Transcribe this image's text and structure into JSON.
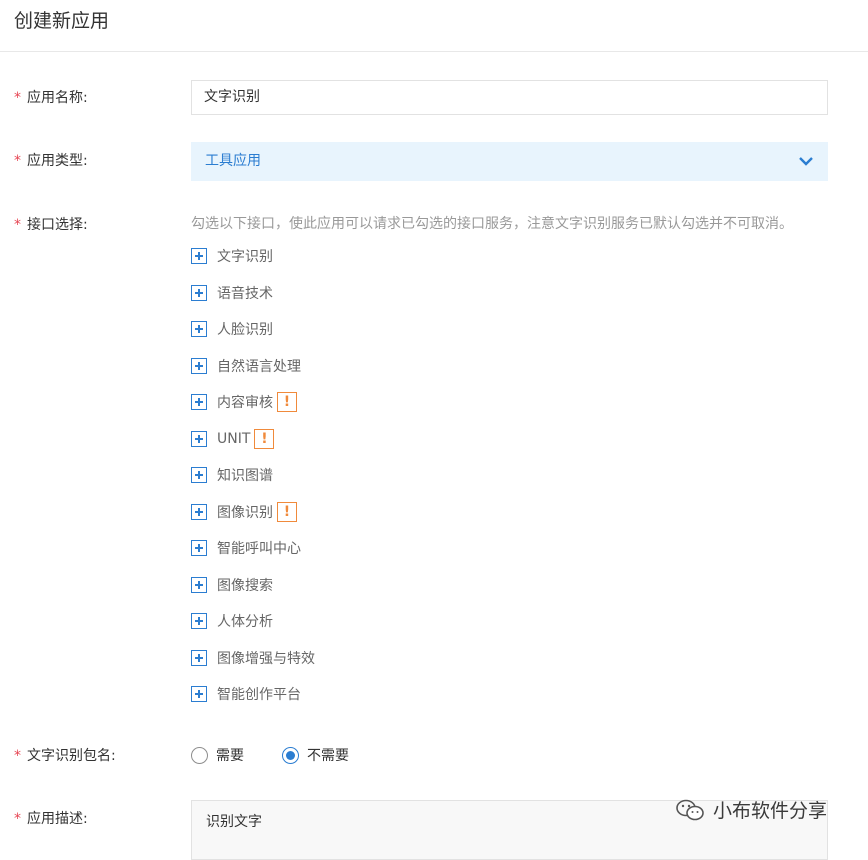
{
  "header": {
    "title": "创建新应用"
  },
  "form": {
    "required_mark": "*",
    "app_name": {
      "label": "应用名称:",
      "value": "文字识别"
    },
    "app_type": {
      "label": "应用类型:",
      "value": "工具应用"
    },
    "api_select": {
      "label": "接口选择:",
      "hint": "勾选以下接口，使此应用可以请求已勾选的接口服务，注意文字识别服务已默认勾选并不可取消。",
      "items": [
        {
          "label": "文字识别",
          "warn": ""
        },
        {
          "label": "语音技术",
          "warn": ""
        },
        {
          "label": "人脸识别",
          "warn": ""
        },
        {
          "label": "自然语言处理",
          "warn": ""
        },
        {
          "label": "内容审核",
          "warn": "!"
        },
        {
          "label": "UNIT",
          "warn": "!"
        },
        {
          "label": "知识图谱",
          "warn": ""
        },
        {
          "label": "图像识别",
          "warn": "!"
        },
        {
          "label": "智能呼叫中心",
          "warn": ""
        },
        {
          "label": "图像搜索",
          "warn": ""
        },
        {
          "label": "人体分析",
          "warn": ""
        },
        {
          "label": "图像增强与特效",
          "warn": ""
        },
        {
          "label": "智能创作平台",
          "warn": ""
        }
      ]
    },
    "package_name": {
      "label": "文字识别包名:",
      "options": [
        {
          "label": "需要",
          "checked": false
        },
        {
          "label": "不需要",
          "checked": true
        }
      ]
    },
    "description": {
      "label": "应用描述:",
      "value": "识别文字"
    }
  },
  "watermark": {
    "text": "小布软件分享"
  },
  "colors": {
    "accent": "#2b7dd1",
    "required": "#e64552",
    "warning": "#f08a3b",
    "select_bg": "#e8f4fd"
  }
}
